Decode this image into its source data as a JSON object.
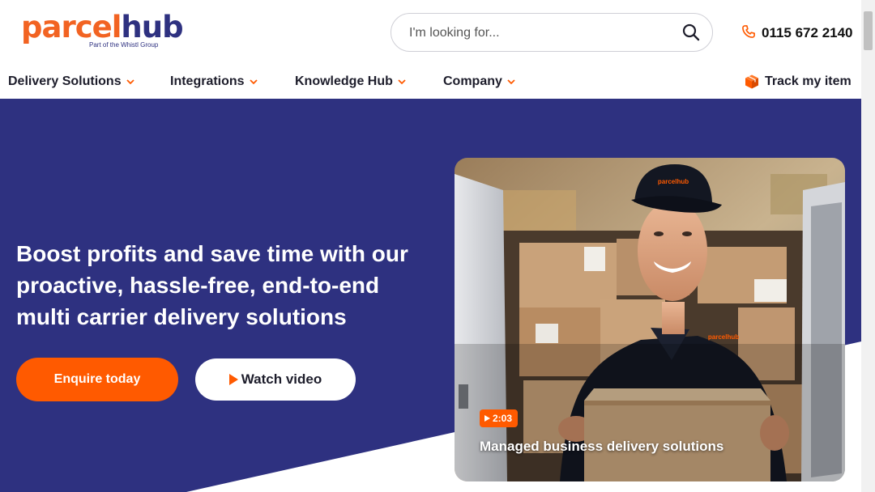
{
  "brand": {
    "name_part1": "parcel",
    "name_part2": "hub",
    "tagline": "Part of the Whistl Group"
  },
  "search": {
    "placeholder": "I'm looking for..."
  },
  "header": {
    "phone": "0115 672 2140"
  },
  "nav": {
    "items": [
      {
        "label": "Delivery Solutions"
      },
      {
        "label": "Integrations"
      },
      {
        "label": "Knowledge Hub"
      },
      {
        "label": "Company"
      }
    ],
    "track_label": "Track my item"
  },
  "hero": {
    "headline": "Boost profits and save time with our proactive, hassle-free, end-to-end multi carrier delivery solutions",
    "enquire_label": "Enquire today",
    "video_label": "Watch video",
    "video_card": {
      "duration": "2:03",
      "title": "Managed business delivery solutions",
      "cap_text": "parcelhub",
      "shirt_text": "parcelhub"
    }
  },
  "colors": {
    "brand_orange": "#ff5a00",
    "brand_navy": "#2e3180",
    "text_dark": "#1d1d2b"
  }
}
